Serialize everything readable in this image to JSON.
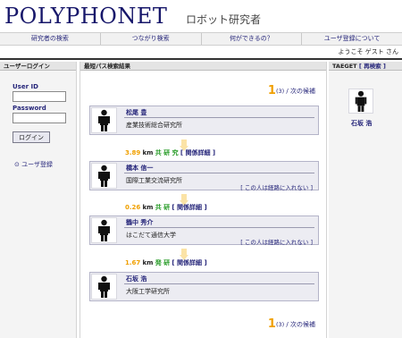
{
  "header": {
    "logo": "POLYPHONET",
    "subtitle": "ロボット研究者"
  },
  "nav": {
    "items": [
      "研究者の検索",
      "つながり検索",
      "何ができるの？",
      "ユーザ登録について"
    ]
  },
  "welcome": "ようこそ ゲスト さん",
  "login": {
    "title": "ユーザーログイン",
    "userid_label": "User ID",
    "password_label": "Password",
    "button": "ログイン",
    "register": "ユーザ登録"
  },
  "results": {
    "title": "最短パス検索結果",
    "pager": {
      "current": "1",
      "total": "(3)",
      "next": "/ 次の候補"
    },
    "people": [
      {
        "name": "松尾 豊",
        "org": "産業技術総合研究所",
        "exclude": ""
      },
      {
        "name": "橋本 信一",
        "org": "国際工業交流研究所",
        "exclude": "[ この人は経路に入れない ]"
      },
      {
        "name": "鶴中 秀介",
        "org": "はこだて通信大学",
        "exclude": "[ この人は経路に入れない ]"
      },
      {
        "name": "石坂 浩",
        "org": "大阪工学研究所",
        "exclude": ""
      }
    ],
    "links": [
      {
        "distance": "3.89",
        "unit": "km",
        "relation": "共 研 究",
        "detail": "[ 関係詳細 ]"
      },
      {
        "distance": "0.26",
        "unit": "km",
        "relation": "共 研",
        "detail": "[ 関係詳細 ]"
      },
      {
        "distance": "1.67",
        "unit": "km",
        "relation": "発 研",
        "detail": "[ 関係詳細 ]"
      }
    ]
  },
  "target": {
    "title": "TAEGET",
    "research": "[ 再検索 ]",
    "name": "石坂 浩"
  }
}
